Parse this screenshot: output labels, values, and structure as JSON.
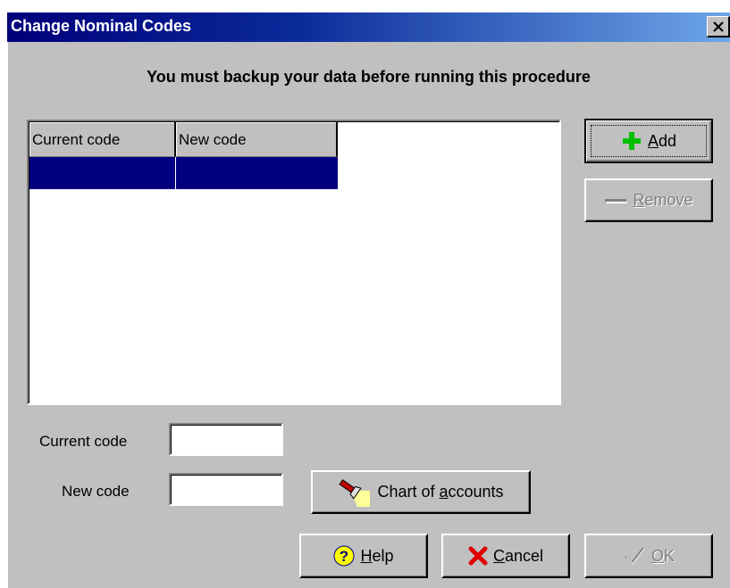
{
  "window": {
    "title": "Change Nominal Codes"
  },
  "warning": "You must backup your data before running this procedure",
  "table": {
    "columns": [
      "Current code",
      "New code"
    ],
    "rows": [
      [
        "",
        ""
      ]
    ]
  },
  "buttons": {
    "add": {
      "pre": "",
      "key": "A",
      "post": "dd",
      "icon": "plus-icon"
    },
    "remove": {
      "pre": "",
      "key": "R",
      "post": "emove",
      "icon": "minus-icon"
    },
    "chart": {
      "pre": "Chart of ",
      "key": "a",
      "post": "ccounts",
      "icon": "flashlight-icon"
    },
    "help": {
      "pre": "",
      "key": "H",
      "post": "elp",
      "icon": "help-icon"
    },
    "cancel": {
      "pre": "",
      "key": "C",
      "post": "ancel",
      "icon": "cancel-icon"
    },
    "ok": {
      "pre": "",
      "key": "O",
      "post": "K",
      "icon": "check-icon"
    }
  },
  "fields": {
    "current_code": {
      "label": "Current code",
      "value": ""
    },
    "new_code": {
      "label": "New code",
      "value": ""
    }
  },
  "colors": {
    "selection": "#000080",
    "face": "#c0c0c0",
    "add_icon": "#00c000",
    "cancel_icon": "#e00000"
  }
}
